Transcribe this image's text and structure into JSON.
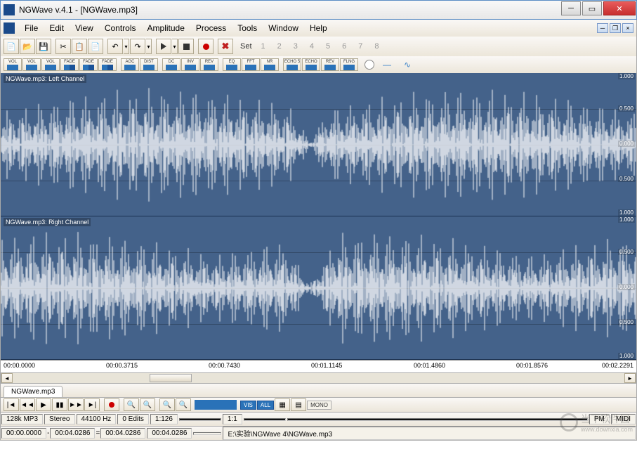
{
  "titlebar": {
    "title": "NGWave v.4.1 - [NGWave.mp3]"
  },
  "menu": {
    "items": [
      "File",
      "Edit",
      "View",
      "Controls",
      "Amplitude",
      "Process",
      "Tools",
      "Window",
      "Help"
    ]
  },
  "toolbar1": {
    "set_label": "Set",
    "set_numbers": [
      "1",
      "2",
      "3",
      "4",
      "5",
      "6",
      "7",
      "8"
    ]
  },
  "toolbar2": {
    "buttons": [
      "VOL",
      "VOL",
      "VOL",
      "FADE",
      "FADE",
      "FADE",
      "AGC",
      "DIST",
      "DC",
      "INV",
      "REV",
      "EQ",
      "FFT",
      "NR",
      "ECHO 5",
      "ECHO",
      "REV",
      "FLNG"
    ]
  },
  "channels": {
    "left_label": "NGWave.mp3: Left Channel",
    "right_label": "NGWave.mp3: Right Channel",
    "amp_top": "1.000",
    "amp_mid_up": "0.500",
    "amp_zero": "0.000",
    "amp_mid_dn": "0.500",
    "amp_bot": "1.000"
  },
  "timeline": {
    "ticks": [
      "00:00.0000",
      "00:00.3715",
      "00:00.7430",
      "00:01.1145",
      "00:01.4860",
      "00:01.8576",
      "00:02.2291"
    ]
  },
  "tab": {
    "name": "NGWave.mp3"
  },
  "transport": {
    "badges": [
      "VIS",
      "ALL",
      "MONO"
    ]
  },
  "status1": {
    "format": "128k MP3",
    "chan": "Stereo",
    "rate": "44100 Hz",
    "edits": "0 Edits",
    "ratio1": "1:126",
    "ratio2": "1:1",
    "pm": "PM",
    "midi": "MIDI"
  },
  "status2": {
    "t1": "00:00.0000",
    "sep": "-",
    "t2": "00:04.0286",
    "eq": "=",
    "t3": "00:04.0286",
    "t4": "00:04.0286",
    "path": "E:\\实验\\NGWave 4\\NGWave.mp3"
  },
  "watermark": {
    "text": "当下软件园",
    "url": "www.downxia.com"
  }
}
